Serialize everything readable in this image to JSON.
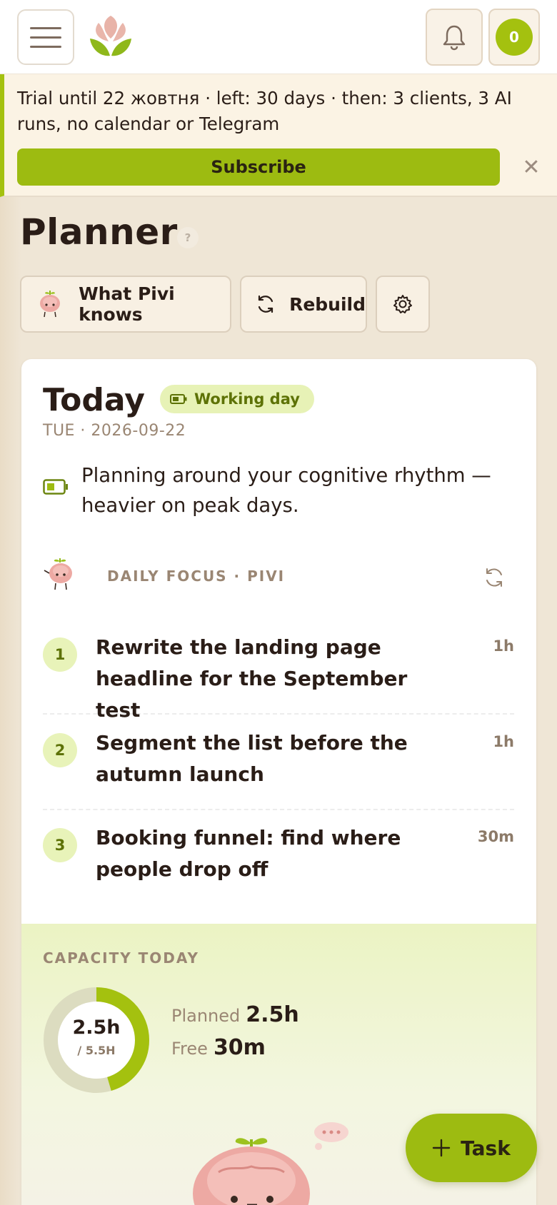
{
  "header": {
    "menu_icon": "hamburger-icon",
    "logo_icon": "lotus-logo-icon",
    "bell_icon": "bell-icon",
    "avatar_count": "0"
  },
  "trial": {
    "text": "Trial until 22 жовтня · left: 30 days · then: 3 clients, 3 AI runs, no calendar or Telegram",
    "subscribe_label": "Subscribe",
    "close_label": "✕"
  },
  "page": {
    "title": "Planner",
    "help_label": "?"
  },
  "actions": {
    "knows_label": "What Pivi knows",
    "rebuild_label": "Rebuild",
    "settings_icon": "gear-icon"
  },
  "today": {
    "title": "Today",
    "badge": "Working day",
    "date": "TUE · 2026-09-22",
    "rhythm_text": "Planning around your cognitive rhythm — heavier on peak days."
  },
  "focus": {
    "label": "DAILY FOCUS · PIVI",
    "tasks": [
      {
        "num": "1",
        "title": "Rewrite the landing page headline for the September test",
        "duration": "1h"
      },
      {
        "num": "2",
        "title": "Segment the list before the autumn launch",
        "duration": "1h"
      },
      {
        "num": "3",
        "title": "Booking funnel: find where people drop off",
        "duration": "30m"
      }
    ]
  },
  "capacity": {
    "label": "CAPACITY TODAY",
    "value": "2.5h",
    "total": "/ 5.5H",
    "fill_fraction": 0.4545,
    "planned_label": "Planned",
    "planned_value": "2.5h",
    "free_label": "Free",
    "free_value": "30m"
  },
  "fab": {
    "label": "Task",
    "icon": "plus-icon"
  },
  "colors": {
    "accent": "#9dbb11",
    "background": "#efe6d6",
    "text": "#2a1d17",
    "muted": "#9a8673"
  }
}
